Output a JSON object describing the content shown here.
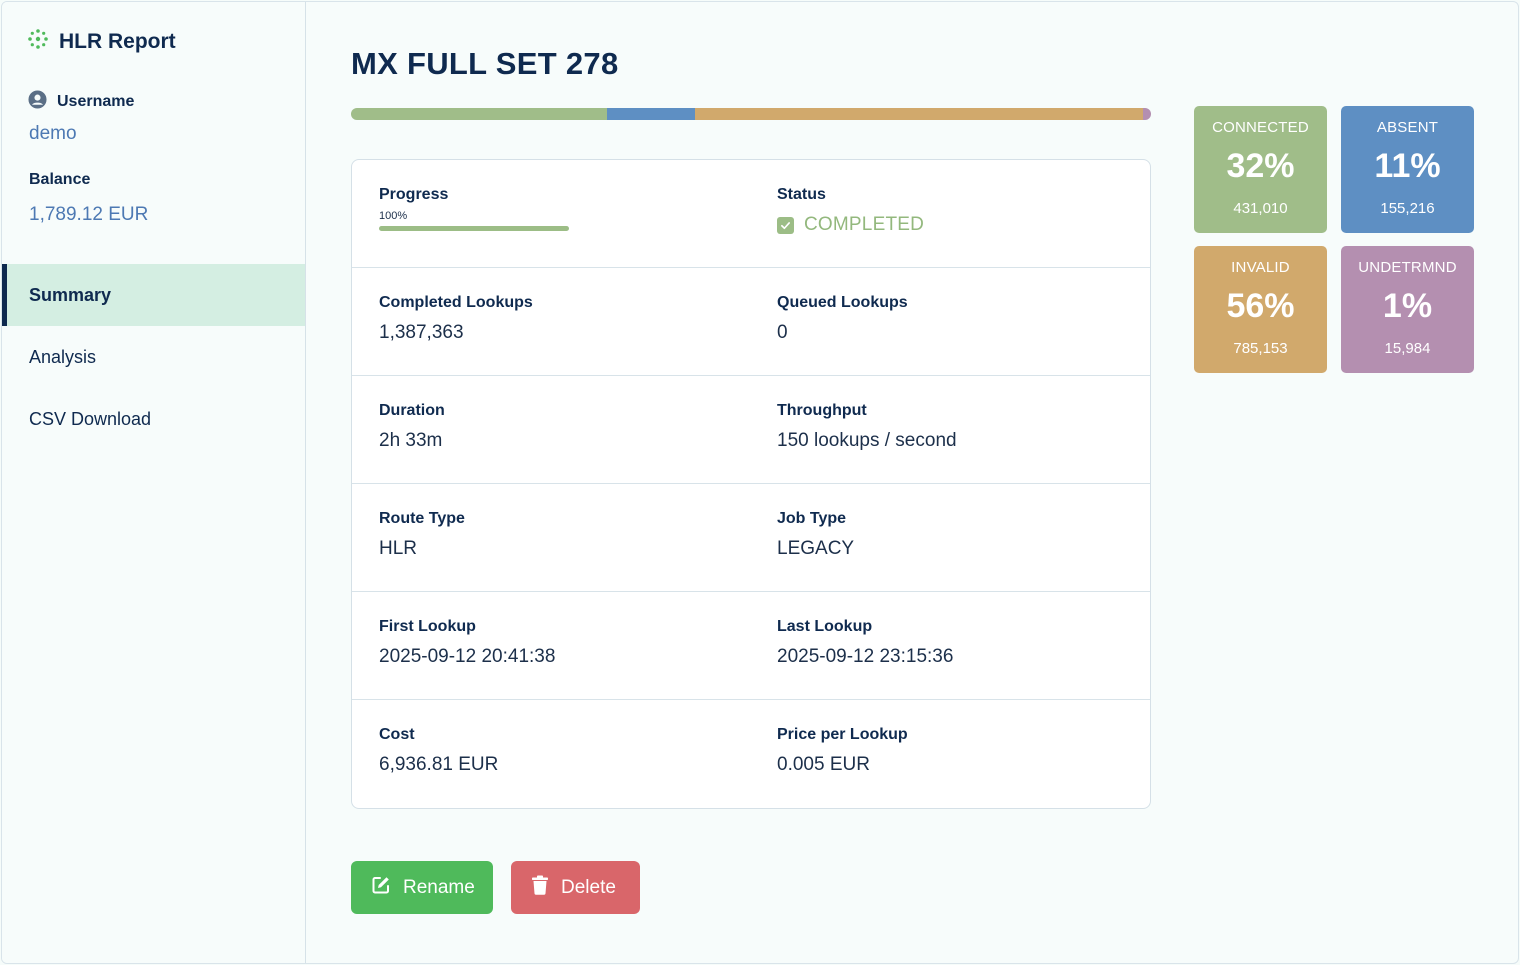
{
  "app": {
    "title": "HLR Report"
  },
  "user": {
    "label": "Username",
    "value": "demo"
  },
  "balance": {
    "label": "Balance",
    "value": "1,789.12 EUR"
  },
  "nav": [
    {
      "label": "Summary",
      "active": true
    },
    {
      "label": "Analysis",
      "active": false
    },
    {
      "label": "CSV Download",
      "active": false
    }
  ],
  "job": {
    "title": "MX FULL SET 278"
  },
  "distribution": [
    {
      "name": "CONNECTED",
      "percent": 32,
      "color": "#a0bd89"
    },
    {
      "name": "ABSENT",
      "percent": 11,
      "color": "#5e8fc3"
    },
    {
      "name": "INVALID",
      "percent": 56,
      "color": "#d1a96c"
    },
    {
      "name": "UNDETRMND",
      "percent": 1,
      "color": "#b48fb0"
    }
  ],
  "details": {
    "progress": {
      "label": "Progress",
      "percent_text": "100%",
      "fraction": 1.0
    },
    "status": {
      "label": "Status",
      "value": "COMPLETED"
    },
    "completed_lookups": {
      "label": "Completed Lookups",
      "value": "1,387,363"
    },
    "queued_lookups": {
      "label": "Queued Lookups",
      "value": "0"
    },
    "duration": {
      "label": "Duration",
      "value": "2h 33m"
    },
    "throughput": {
      "label": "Throughput",
      "value": "150 lookups / second"
    },
    "route_type": {
      "label": "Route Type",
      "value": "HLR"
    },
    "job_type": {
      "label": "Job Type",
      "value": "LEGACY"
    },
    "first_lookup": {
      "label": "First Lookup",
      "value": "2025-09-12 20:41:38"
    },
    "last_lookup": {
      "label": "Last Lookup",
      "value": "2025-09-12 23:15:36"
    },
    "cost": {
      "label": "Cost",
      "value": "6,936.81 EUR"
    },
    "price_per_lookup": {
      "label": "Price per Lookup",
      "value": "0.005 EUR"
    }
  },
  "actions": {
    "rename_label": "Rename",
    "delete_label": "Delete"
  },
  "stats": [
    {
      "label": "CONNECTED",
      "percent": "32%",
      "count": "431,010",
      "color": "#a0bd89"
    },
    {
      "label": "ABSENT",
      "percent": "11%",
      "count": "155,216",
      "color": "#5e8fc3"
    },
    {
      "label": "INVALID",
      "percent": "56%",
      "count": "785,153",
      "color": "#d1a96c"
    },
    {
      "label": "UNDETRMND",
      "percent": "1%",
      "count": "15,984",
      "color": "#b48fb0"
    }
  ]
}
